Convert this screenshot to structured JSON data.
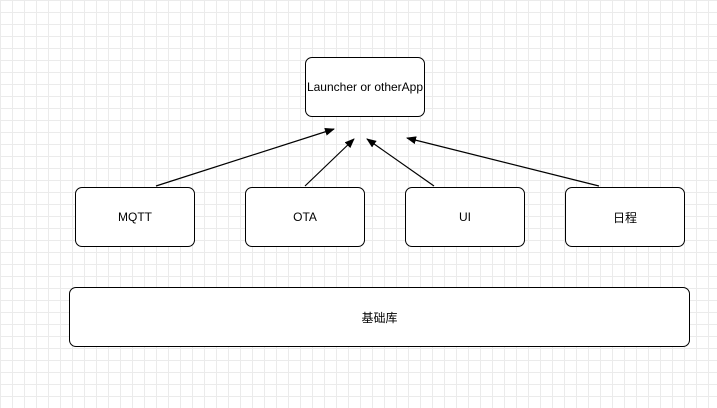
{
  "diagram": {
    "nodes": {
      "launcher": {
        "label": "Launcher or otherApp"
      },
      "mqtt": {
        "label": "MQTT"
      },
      "ota": {
        "label": "OTA"
      },
      "ui": {
        "label": "UI"
      },
      "schedule": {
        "label": "日程"
      },
      "base_library": {
        "label": "基础库"
      }
    },
    "edges": [
      {
        "from": "mqtt",
        "to": "launcher"
      },
      {
        "from": "ota",
        "to": "launcher"
      },
      {
        "from": "ui",
        "to": "launcher"
      },
      {
        "from": "schedule",
        "to": "launcher"
      }
    ]
  }
}
